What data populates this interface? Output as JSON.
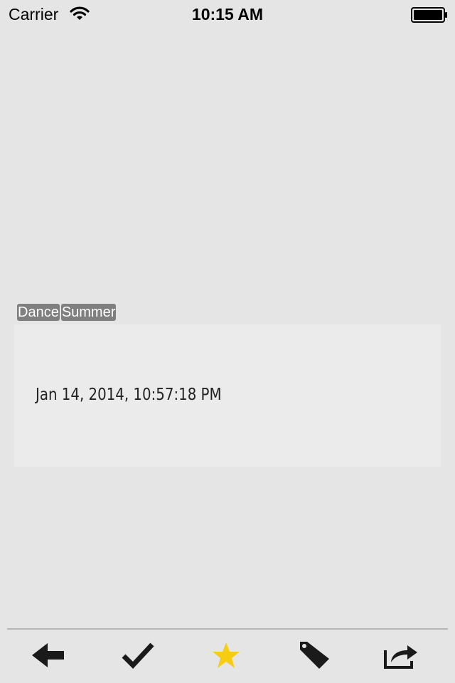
{
  "status_bar": {
    "carrier": "Carrier",
    "time": "10:15 AM",
    "wifi_icon": "wifi-icon",
    "battery_icon": "battery-icon"
  },
  "tags": [
    "Dance",
    "Summer"
  ],
  "card": {
    "date": "Jan 14, 2014, 10:57:18 PM"
  },
  "toolbar": {
    "items": [
      {
        "icon": "back-arrow-icon"
      },
      {
        "icon": "checkmark-icon"
      },
      {
        "icon": "star-icon",
        "color": "#f6cd13"
      },
      {
        "icon": "tag-icon"
      },
      {
        "icon": "share-icon"
      }
    ]
  }
}
